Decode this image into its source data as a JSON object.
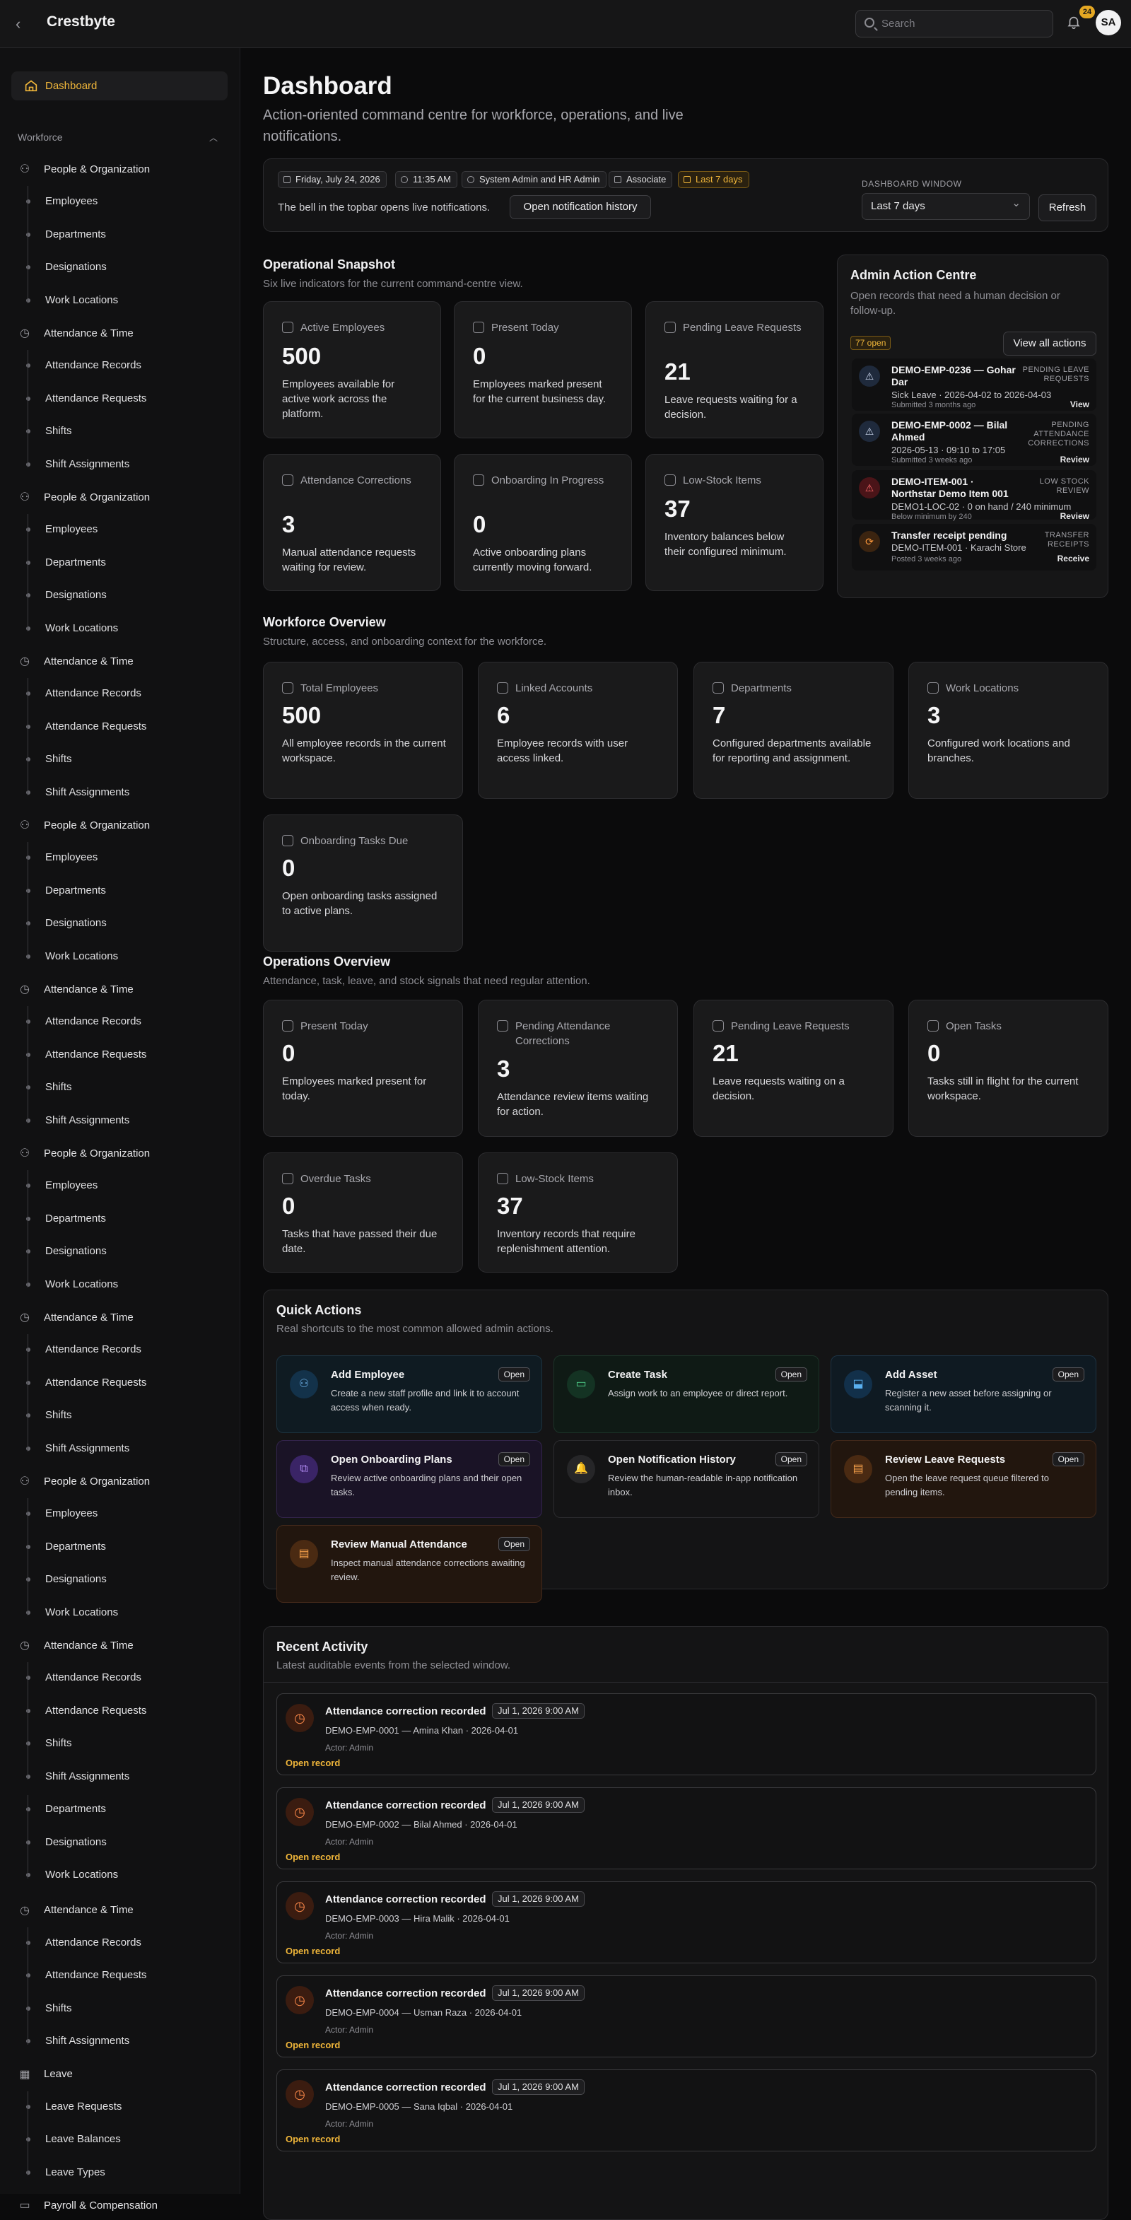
{
  "topbar": {
    "brand": "Crestbyte",
    "search_placeholder": "Search",
    "notif_count": "24",
    "avatar": "SA"
  },
  "sidebar": {
    "dashboard": "Dashboard",
    "section": "Workforce",
    "groups": [
      {
        "label": "People & Organization",
        "icon": "people-icon",
        "subs": [
          "Employees",
          "Departments",
          "Designations",
          "Work Locations"
        ]
      },
      {
        "label": "Attendance & Time",
        "icon": "clock-icon",
        "subs": [
          "Attendance Records",
          "Attendance Requests",
          "Shifts",
          "Shift Assignments"
        ]
      }
    ],
    "tail_subs": [
      "Departments",
      "Designations",
      "Work Locations"
    ],
    "tail_group": {
      "label": "Attendance & Time",
      "subs": [
        "Attendance Records",
        "Attendance Requests",
        "Shifts",
        "Shift Assignments"
      ]
    },
    "leave": {
      "label": "Leave",
      "subs": [
        "Leave Requests",
        "Leave Balances",
        "Leave Types"
      ]
    },
    "payroll": "Payroll & Compensation"
  },
  "header": {
    "title": "Dashboard",
    "lead": "Action-oriented command centre for workforce, operations, and live notifications."
  },
  "context": {
    "chips": [
      "Friday, July 24, 2026",
      "11:35 AM",
      "System Admin and HR Admin",
      "Associate",
      "Last 7 days"
    ],
    "note": "The bell in the topbar opens live notifications.",
    "history_btn": "Open notification history",
    "window_label": "DASHBOARD WINDOW",
    "window_value": "Last 7 days",
    "refresh": "Refresh"
  },
  "snapshot": {
    "title": "Operational Snapshot",
    "sub": "Six live indicators for the current command-centre view.",
    "cards": [
      {
        "title": "Active Employees",
        "value": "500",
        "desc": "Employees available for active work across the platform."
      },
      {
        "title": "Present Today",
        "value": "0",
        "desc": "Employees marked present for the current business day."
      },
      {
        "title": "Pending Leave Requests",
        "value": "21",
        "desc": "Leave requests waiting for a decision."
      },
      {
        "title": "Attendance Corrections",
        "value": "3",
        "desc": "Manual attendance requests waiting for review."
      },
      {
        "title": "Onboarding In Progress",
        "value": "0",
        "desc": "Active onboarding plans currently moving forward."
      },
      {
        "title": "Low-Stock Items",
        "value": "37",
        "desc": "Inventory balances below their configured minimum."
      }
    ]
  },
  "admin": {
    "title": "Admin Action Centre",
    "sub": "Open records that need a human decision or follow-up.",
    "open": "77 open",
    "view_all": "View all actions",
    "items": [
      {
        "title": "DEMO-EMP-0236 — Gohar Dar",
        "kind": "PENDING LEAVE REQUESTS",
        "detail": "Sick Leave · 2026-04-02 to 2026-04-03",
        "when": "Submitted 3 months ago",
        "action": "View",
        "tone": "blue"
      },
      {
        "title": "DEMO-EMP-0002 — Bilal Ahmed",
        "kind": "PENDING ATTENDANCE CORRECTIONS",
        "detail": "2026-05-13 · 09:10 to 17:05",
        "when": "Submitted 3 weeks ago",
        "action": "Review",
        "tone": "blue"
      },
      {
        "title": "DEMO-ITEM-001 · Northstar Demo Item 001",
        "kind": "LOW STOCK REVIEW",
        "detail": "DEMO1-LOC-02 · 0 on hand / 240 minimum",
        "when": "Below minimum by 240",
        "action": "Review",
        "tone": "red"
      },
      {
        "title": "Transfer receipt pending",
        "kind": "TRANSFER RECEIPTS",
        "detail": "DEMO-ITEM-001 · Karachi Store",
        "when": "Posted 3 weeks ago",
        "action": "Receive",
        "tone": "orange"
      }
    ]
  },
  "workforce": {
    "title": "Workforce Overview",
    "sub": "Structure, access, and onboarding context for the workforce.",
    "cards": [
      {
        "title": "Total Employees",
        "value": "500",
        "desc": "All employee records in the current workspace."
      },
      {
        "title": "Linked Accounts",
        "value": "6",
        "desc": "Employee records with user access linked."
      },
      {
        "title": "Departments",
        "value": "7",
        "desc": "Configured departments available for reporting and assignment."
      },
      {
        "title": "Work Locations",
        "value": "3",
        "desc": "Configured work locations and branches."
      },
      {
        "title": "Onboarding Tasks Due",
        "value": "0",
        "desc": "Open onboarding tasks assigned to active plans."
      }
    ]
  },
  "operations": {
    "title": "Operations Overview",
    "sub": "Attendance, task, leave, and stock signals that need regular attention.",
    "cards": [
      {
        "title": "Present Today",
        "value": "0",
        "desc": "Employees marked present for today."
      },
      {
        "title": "Pending Attendance Corrections",
        "value": "3",
        "desc": "Attendance review items waiting for action."
      },
      {
        "title": "Pending Leave Requests",
        "value": "21",
        "desc": "Leave requests waiting on a decision."
      },
      {
        "title": "Open Tasks",
        "value": "0",
        "desc": "Tasks still in flight for the current workspace."
      },
      {
        "title": "Overdue Tasks",
        "value": "0",
        "desc": "Tasks that have passed their due date."
      },
      {
        "title": "Low-Stock Items",
        "value": "37",
        "desc": "Inventory records that require replenishment attention."
      }
    ]
  },
  "quick": {
    "title": "Quick Actions",
    "sub": "Real shortcuts to the most common allowed admin actions.",
    "open_label": "Open",
    "items": [
      {
        "title": "Add Employee",
        "desc": "Create a new staff profile and link it to account access when ready.",
        "bg": "#0f1b22",
        "border": "#1d3340",
        "iconbg": "#13324a",
        "iconfg": "#6fb2e8"
      },
      {
        "title": "Create Task",
        "desc": "Assign work to an employee or direct report.",
        "bg": "#0f1a15",
        "border": "#1c3328",
        "iconbg": "#143323",
        "iconfg": "#4fd08a"
      },
      {
        "title": "Add Asset",
        "desc": "Register a new asset before assigning or scanning it.",
        "bg": "#0f1a22",
        "border": "#1d3344",
        "iconbg": "#12304a",
        "iconfg": "#5ab0f0"
      },
      {
        "title": "Open Onboarding Plans",
        "desc": "Review active onboarding plans and their open tasks.",
        "bg": "#1a1326",
        "border": "#33244c",
        "iconbg": "#3a2466",
        "iconfg": "#b28cf5"
      },
      {
        "title": "Open Notification History",
        "desc": "Review the human-readable in-app notification inbox.",
        "bg": "#141415",
        "border": "#2c2c2f",
        "iconbg": "#262628",
        "iconfg": "#b0b0b5"
      },
      {
        "title": "Review Leave Requests",
        "desc": "Open the leave request queue filtered to pending items.",
        "bg": "#22160e",
        "border": "#43291a",
        "iconbg": "#4a2a12",
        "iconfg": "#f5a04a"
      },
      {
        "title": "Review Manual Attendance",
        "desc": "Inspect manual attendance corrections awaiting review.",
        "bg": "#22160e",
        "border": "#43291a",
        "iconbg": "#4a2a12",
        "iconfg": "#f5a04a"
      }
    ]
  },
  "recent": {
    "title": "Recent Activity",
    "sub": "Latest auditable events from the selected window.",
    "link": "Open record",
    "items": [
      {
        "title": "Attendance correction recorded",
        "date": "Jul 1, 2026 9:00 AM",
        "sub": "DEMO-EMP-0001 — Amina Khan · 2026-04-01",
        "actor": "Actor: Admin"
      },
      {
        "title": "Attendance correction recorded",
        "date": "Jul 1, 2026 9:00 AM",
        "sub": "DEMO-EMP-0002 — Bilal Ahmed · 2026-04-01",
        "actor": "Actor: Admin"
      },
      {
        "title": "Attendance correction recorded",
        "date": "Jul 1, 2026 9:00 AM",
        "sub": "DEMO-EMP-0003 — Hira Malik · 2026-04-01",
        "actor": "Actor: Admin"
      },
      {
        "title": "Attendance correction recorded",
        "date": "Jul 1, 2026 9:00 AM",
        "sub": "DEMO-EMP-0004 — Usman Raza · 2026-04-01",
        "actor": "Actor: Admin"
      },
      {
        "title": "Attendance correction recorded",
        "date": "Jul 1, 2026 9:00 AM",
        "sub": "DEMO-EMP-0005 — Sana Iqbal · 2026-04-01",
        "actor": "Actor: Admin"
      }
    ]
  }
}
